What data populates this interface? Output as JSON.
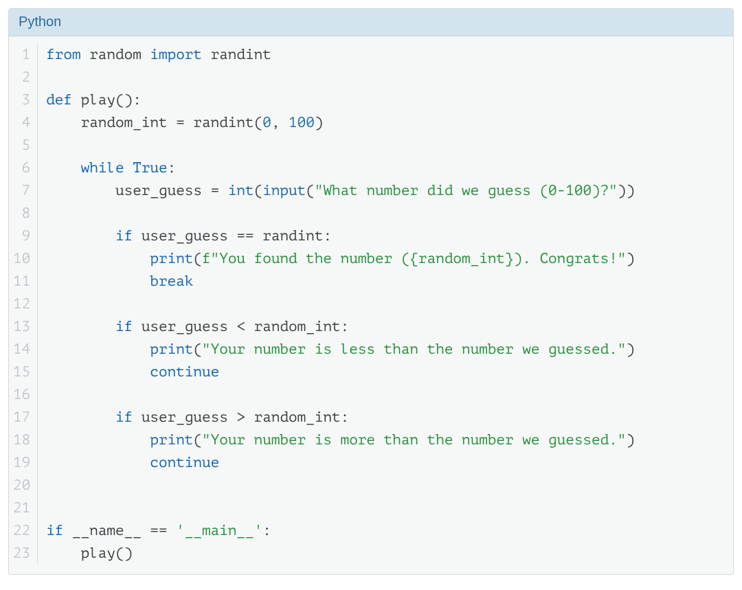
{
  "header": {
    "language_label": "Python"
  },
  "code": {
    "line_count": 23,
    "lines": [
      [
        {
          "t": "from ",
          "c": "tok-kw"
        },
        {
          "t": "random ",
          "c": "tok-name"
        },
        {
          "t": "import ",
          "c": "tok-kw"
        },
        {
          "t": "randint",
          "c": "tok-name"
        }
      ],
      [],
      [
        {
          "t": "def ",
          "c": "tok-kw"
        },
        {
          "t": "play",
          "c": "tok-func"
        },
        {
          "t": "():",
          "c": "tok-punc"
        }
      ],
      [
        {
          "t": "    random_int ",
          "c": "tok-name"
        },
        {
          "t": "= ",
          "c": "tok-op"
        },
        {
          "t": "randint",
          "c": "tok-name"
        },
        {
          "t": "(",
          "c": "tok-punc"
        },
        {
          "t": "0",
          "c": "tok-num"
        },
        {
          "t": ", ",
          "c": "tok-punc"
        },
        {
          "t": "100",
          "c": "tok-num"
        },
        {
          "t": ")",
          "c": "tok-punc"
        }
      ],
      [],
      [
        {
          "t": "    ",
          "c": "tok-name"
        },
        {
          "t": "while ",
          "c": "tok-kw"
        },
        {
          "t": "True",
          "c": "tok-bool"
        },
        {
          "t": ":",
          "c": "tok-punc"
        }
      ],
      [
        {
          "t": "        user_guess ",
          "c": "tok-name"
        },
        {
          "t": "= ",
          "c": "tok-op"
        },
        {
          "t": "int",
          "c": "tok-call"
        },
        {
          "t": "(",
          "c": "tok-punc"
        },
        {
          "t": "input",
          "c": "tok-call"
        },
        {
          "t": "(",
          "c": "tok-punc"
        },
        {
          "t": "\"What number did we guess (0-100)?\"",
          "c": "tok-str"
        },
        {
          "t": "))",
          "c": "tok-punc"
        }
      ],
      [],
      [
        {
          "t": "        ",
          "c": "tok-name"
        },
        {
          "t": "if ",
          "c": "tok-kw"
        },
        {
          "t": "user_guess ",
          "c": "tok-name"
        },
        {
          "t": "== ",
          "c": "tok-op"
        },
        {
          "t": "randint",
          "c": "tok-name"
        },
        {
          "t": ":",
          "c": "tok-punc"
        }
      ],
      [
        {
          "t": "            ",
          "c": "tok-name"
        },
        {
          "t": "print",
          "c": "tok-call"
        },
        {
          "t": "(",
          "c": "tok-punc"
        },
        {
          "t": "f\"You found the number ({random_int}). Congrats!\"",
          "c": "tok-str"
        },
        {
          "t": ")",
          "c": "tok-punc"
        }
      ],
      [
        {
          "t": "            ",
          "c": "tok-name"
        },
        {
          "t": "break",
          "c": "tok-kw"
        }
      ],
      [],
      [
        {
          "t": "        ",
          "c": "tok-name"
        },
        {
          "t": "if ",
          "c": "tok-kw"
        },
        {
          "t": "user_guess ",
          "c": "tok-name"
        },
        {
          "t": "< ",
          "c": "tok-op"
        },
        {
          "t": "random_int",
          "c": "tok-name"
        },
        {
          "t": ":",
          "c": "tok-punc"
        }
      ],
      [
        {
          "t": "            ",
          "c": "tok-name"
        },
        {
          "t": "print",
          "c": "tok-call"
        },
        {
          "t": "(",
          "c": "tok-punc"
        },
        {
          "t": "\"Your number is less than the number we guessed.\"",
          "c": "tok-str"
        },
        {
          "t": ")",
          "c": "tok-punc"
        }
      ],
      [
        {
          "t": "            ",
          "c": "tok-name"
        },
        {
          "t": "continue",
          "c": "tok-kw"
        }
      ],
      [],
      [
        {
          "t": "        ",
          "c": "tok-name"
        },
        {
          "t": "if ",
          "c": "tok-kw"
        },
        {
          "t": "user_guess ",
          "c": "tok-name"
        },
        {
          "t": "> ",
          "c": "tok-op"
        },
        {
          "t": "random_int",
          "c": "tok-name"
        },
        {
          "t": ":",
          "c": "tok-punc"
        }
      ],
      [
        {
          "t": "            ",
          "c": "tok-name"
        },
        {
          "t": "print",
          "c": "tok-call"
        },
        {
          "t": "(",
          "c": "tok-punc"
        },
        {
          "t": "\"Your number is more than the number we guessed.\"",
          "c": "tok-str"
        },
        {
          "t": ")",
          "c": "tok-punc"
        }
      ],
      [
        {
          "t": "            ",
          "c": "tok-name"
        },
        {
          "t": "continue",
          "c": "tok-kw"
        }
      ],
      [],
      [],
      [
        {
          "t": "if ",
          "c": "tok-kw"
        },
        {
          "t": "__name__ ",
          "c": "tok-name"
        },
        {
          "t": "== ",
          "c": "tok-op"
        },
        {
          "t": "'__main__'",
          "c": "tok-str"
        },
        {
          "t": ":",
          "c": "tok-punc"
        }
      ],
      [
        {
          "t": "    play",
          "c": "tok-name"
        },
        {
          "t": "()",
          "c": "tok-punc"
        }
      ]
    ]
  }
}
